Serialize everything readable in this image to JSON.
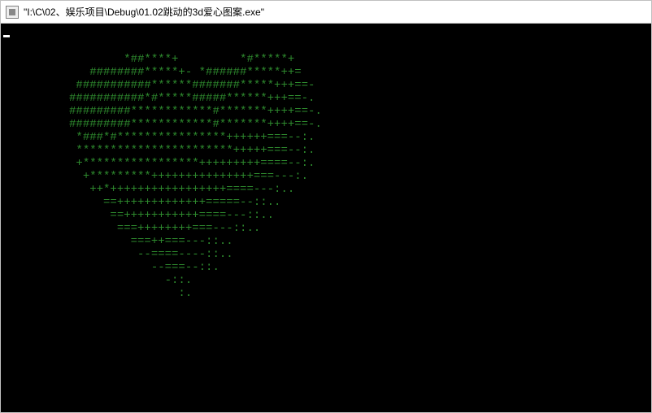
{
  "window": {
    "title": "\"I:\\C\\02、娱乐项目\\Debug\\01.02跳动的3d爱心图案.exe\""
  },
  "console": {
    "ascii_lines": [
      "                  *##****+         *#*****+",
      "             ########*****+- *######*****++=",
      "           ###########******#######*****+++==-",
      "          ###########*#*****#####******+++==-.",
      "          #########************#*******++++==-.",
      "          #########************#*******++++==-.",
      "           *###*#****************++++++===--:.",
      "           ***********************+++++===--:.",
      "           +*****************+++++++++====--:.",
      "            +*********+++++++++++++++===---:.",
      "             ++*+++++++++++++++++====---:..",
      "               ==+++++++++++++=====--::..",
      "                ==+++++++++++====---::..",
      "                 ===++++++++===---::..",
      "                   ===++===---::..",
      "                    --====----::..",
      "                      --===--::.",
      "                        -::.",
      "                          :."
    ]
  }
}
